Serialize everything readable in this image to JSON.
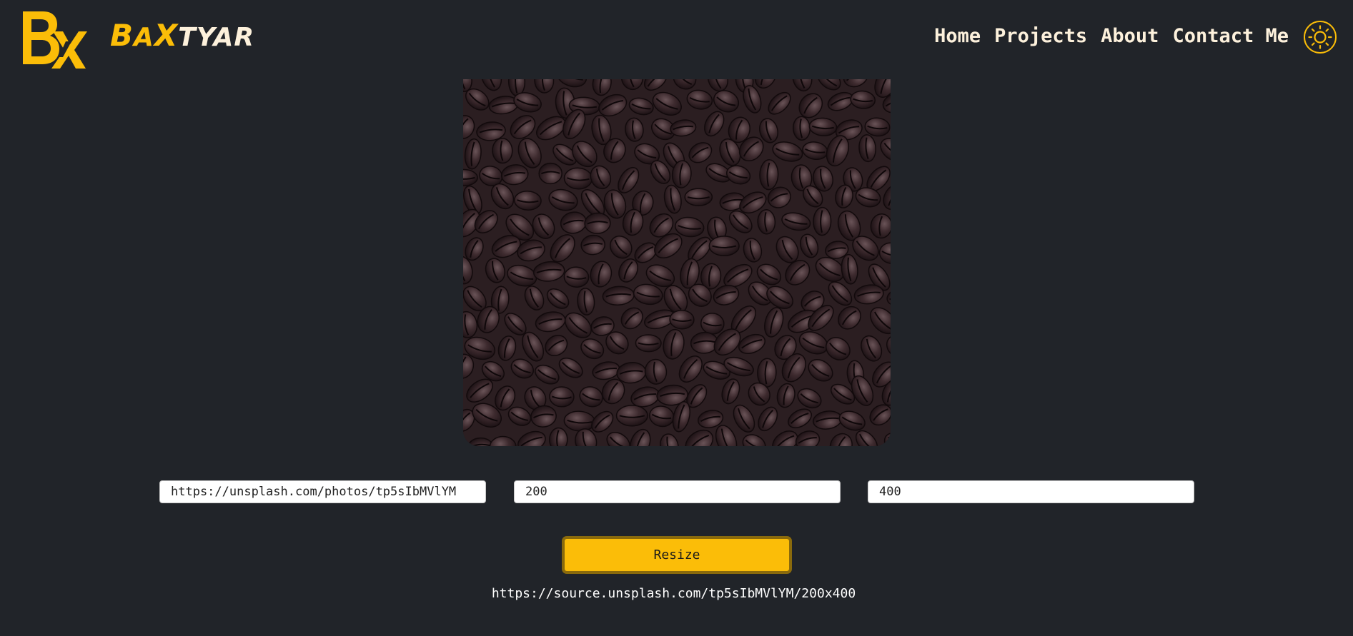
{
  "header": {
    "logo_icon": "bx-logo-icon",
    "brand": {
      "b": "B",
      "a": "A",
      "x": "X",
      "rest": "TYAR"
    },
    "nav": [
      {
        "label": "Home"
      },
      {
        "label": "Projects"
      },
      {
        "label": "About"
      },
      {
        "label": "Contact Me"
      }
    ],
    "theme_icon": "sun-icon"
  },
  "main": {
    "image_icon": "coffee-beans-image",
    "url_input": {
      "value": "https://unsplash.com/photos/tp5sIbMVlYM"
    },
    "width_input": {
      "value": "200"
    },
    "height_input": {
      "value": "400"
    },
    "resize_label": "Resize",
    "result_url": "https://source.unsplash.com/tp5sIbMVlYM/200x400"
  },
  "colors": {
    "background": "#212429",
    "accent": "#fbbd08",
    "text": "#fdf1dc"
  }
}
